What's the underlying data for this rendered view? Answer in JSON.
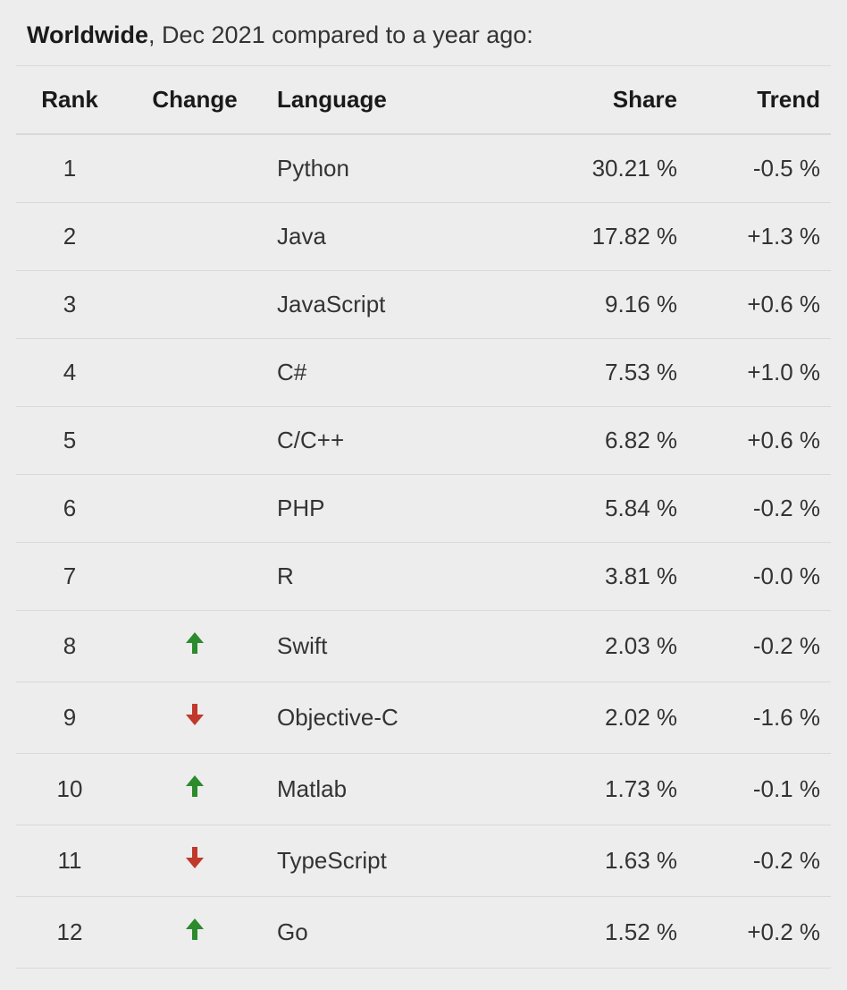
{
  "caption": {
    "bold": "Worldwide",
    "rest": ", Dec 2021 compared to a year ago:"
  },
  "headers": {
    "rank": "Rank",
    "change": "Change",
    "language": "Language",
    "share": "Share",
    "trend": "Trend"
  },
  "rows": [
    {
      "rank": "1",
      "change": "",
      "language": "Python",
      "share": "30.21 %",
      "trend": "-0.5 %"
    },
    {
      "rank": "2",
      "change": "",
      "language": "Java",
      "share": "17.82 %",
      "trend": "+1.3 %"
    },
    {
      "rank": "3",
      "change": "",
      "language": "JavaScript",
      "share": "9.16 %",
      "trend": "+0.6 %"
    },
    {
      "rank": "4",
      "change": "",
      "language": "C#",
      "share": "7.53 %",
      "trend": "+1.0 %"
    },
    {
      "rank": "5",
      "change": "",
      "language": "C/C++",
      "share": "6.82 %",
      "trend": "+0.6 %"
    },
    {
      "rank": "6",
      "change": "",
      "language": "PHP",
      "share": "5.84 %",
      "trend": "-0.2 %"
    },
    {
      "rank": "7",
      "change": "",
      "language": "R",
      "share": "3.81 %",
      "trend": "-0.0 %"
    },
    {
      "rank": "8",
      "change": "up",
      "language": "Swift",
      "share": "2.03 %",
      "trend": "-0.2 %"
    },
    {
      "rank": "9",
      "change": "down",
      "language": "Objective-C",
      "share": "2.02 %",
      "trend": "-1.6 %"
    },
    {
      "rank": "10",
      "change": "up",
      "language": "Matlab",
      "share": "1.73 %",
      "trend": "-0.1 %"
    },
    {
      "rank": "11",
      "change": "down",
      "language": "TypeScript",
      "share": "1.63 %",
      "trend": "-0.2 %"
    },
    {
      "rank": "12",
      "change": "up",
      "language": "Go",
      "share": "1.52 %",
      "trend": "+0.2 %"
    }
  ],
  "colors": {
    "up": "#2d8a2d",
    "down": "#c0392b"
  },
  "chart_data": {
    "type": "table",
    "title": "Worldwide, Dec 2021 compared to a year ago",
    "columns": [
      "Rank",
      "Change",
      "Language",
      "Share",
      "Trend"
    ],
    "rows": [
      [
        1,
        "",
        "Python",
        30.21,
        -0.5
      ],
      [
        2,
        "",
        "Java",
        17.82,
        1.3
      ],
      [
        3,
        "",
        "JavaScript",
        9.16,
        0.6
      ],
      [
        4,
        "",
        "C#",
        7.53,
        1.0
      ],
      [
        5,
        "",
        "C/C++",
        6.82,
        0.6
      ],
      [
        6,
        "",
        "PHP",
        5.84,
        -0.2
      ],
      [
        7,
        "",
        "R",
        3.81,
        -0.0
      ],
      [
        8,
        "up",
        "Swift",
        2.03,
        -0.2
      ],
      [
        9,
        "down",
        "Objective-C",
        2.02,
        -1.6
      ],
      [
        10,
        "up",
        "Matlab",
        1.73,
        -0.1
      ],
      [
        11,
        "down",
        "TypeScript",
        1.63,
        -0.2
      ],
      [
        12,
        "up",
        "Go",
        1.52,
        0.2
      ]
    ]
  }
}
